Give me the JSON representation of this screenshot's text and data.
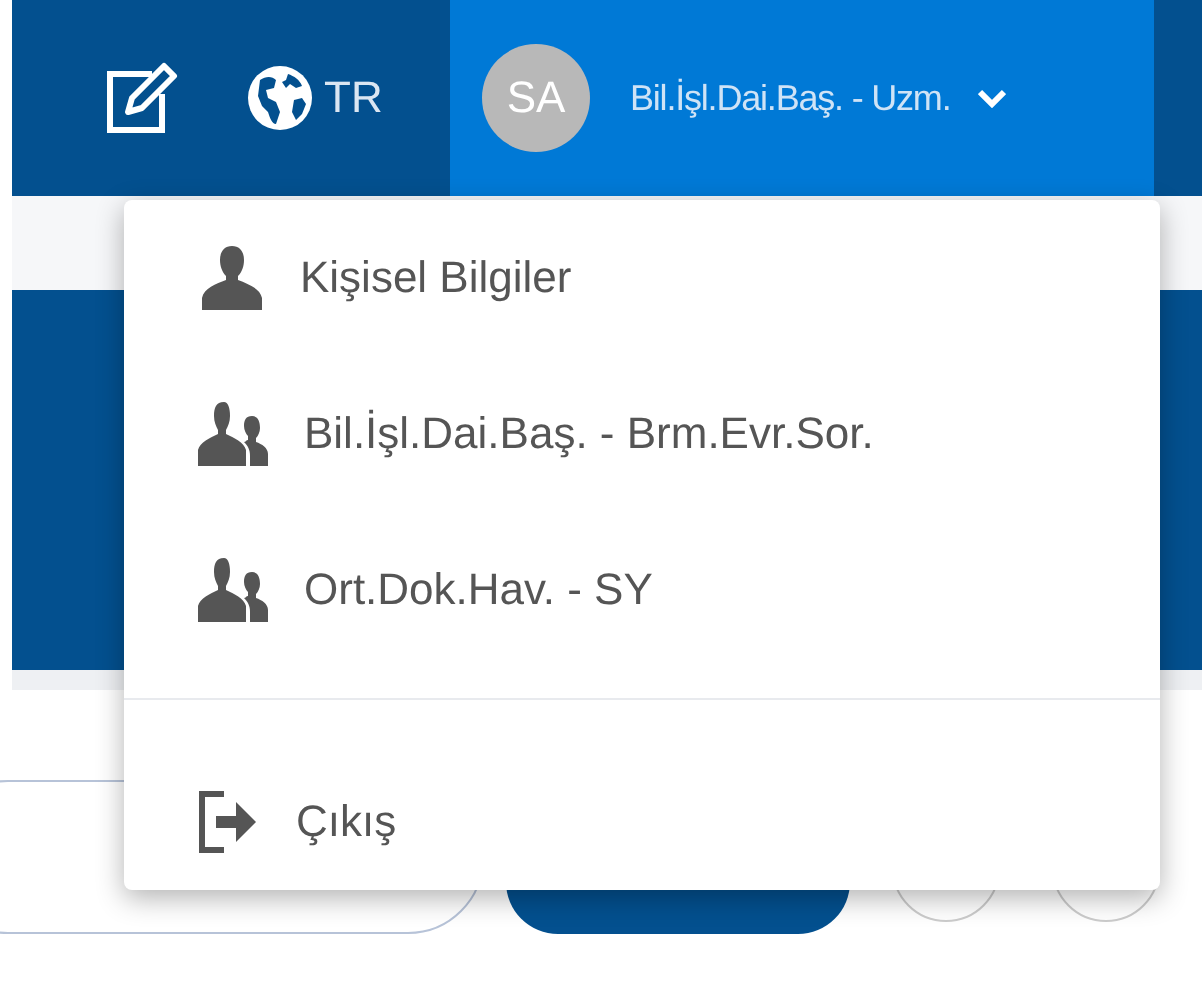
{
  "top_bar": {
    "language": "TR",
    "user": {
      "initials": "SA",
      "role": "Bil.İşl.Dai.Baş. - Uzm.",
      "expanded": true
    }
  },
  "user_menu": {
    "items": [
      {
        "kind": "profile",
        "label": "Kişisel Bilgiler"
      },
      {
        "kind": "role",
        "label": "Bil.İşl.Dai.Baş. - Brm.Evr.Sor."
      },
      {
        "kind": "role",
        "label": "Ort.Dok.Hav. - SY"
      },
      {
        "kind": "logout",
        "label": "Çıkış"
      }
    ]
  }
}
